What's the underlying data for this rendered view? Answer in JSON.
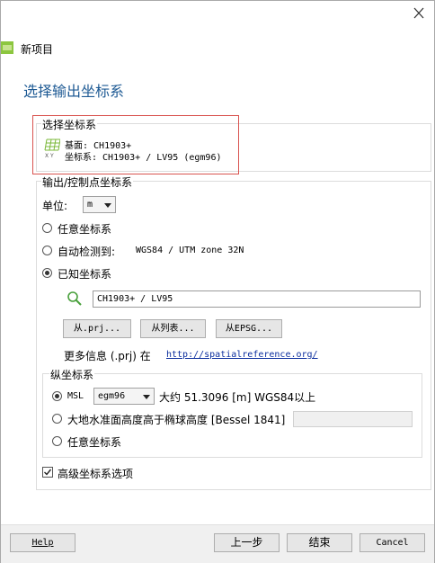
{
  "window": {
    "title": "新项目"
  },
  "page_title": "选择输出坐标系",
  "selected_crs": {
    "group_label": "选择坐标系",
    "base_line": "基面: CH1903+",
    "crs_line": "坐标系: CH1903+ / LV95 (egm96)"
  },
  "output_crs": {
    "group_label": "输出/控制点坐标系",
    "unit_label": "单位:",
    "unit_value": "m",
    "options": {
      "arbitrary": "任意坐标系",
      "auto_detect": "自动检测到:",
      "auto_detect_value": "WGS84 / UTM zone 32N",
      "known": "已知坐标系"
    },
    "known_value": "CH1903+ / LV95",
    "buttons": {
      "from_prj": "从.prj...",
      "from_list": "从列表...",
      "from_epsg": "从EPSG..."
    },
    "more_info_text": "更多信息 (.prj) 在",
    "more_info_link": "http://spatialreference.org/"
  },
  "vertical_crs": {
    "group_label": "纵坐标系",
    "msl_label": "MSL",
    "geoid_value": "egm96",
    "msl_info": "大约 51.3096 [m] WGS84以上",
    "ellipsoid_label": "大地水准面高度高于椭球高度 [Bessel 1841]",
    "arbitrary": "任意坐标系"
  },
  "advanced_label": "高级坐标系选项",
  "footer": {
    "help": "Help",
    "back": "上一步",
    "finish": "结束",
    "cancel": "Cancel"
  },
  "colors": {
    "title": "#1e5a94",
    "highlight": "#d9534f",
    "link": "#0b2e9e"
  }
}
